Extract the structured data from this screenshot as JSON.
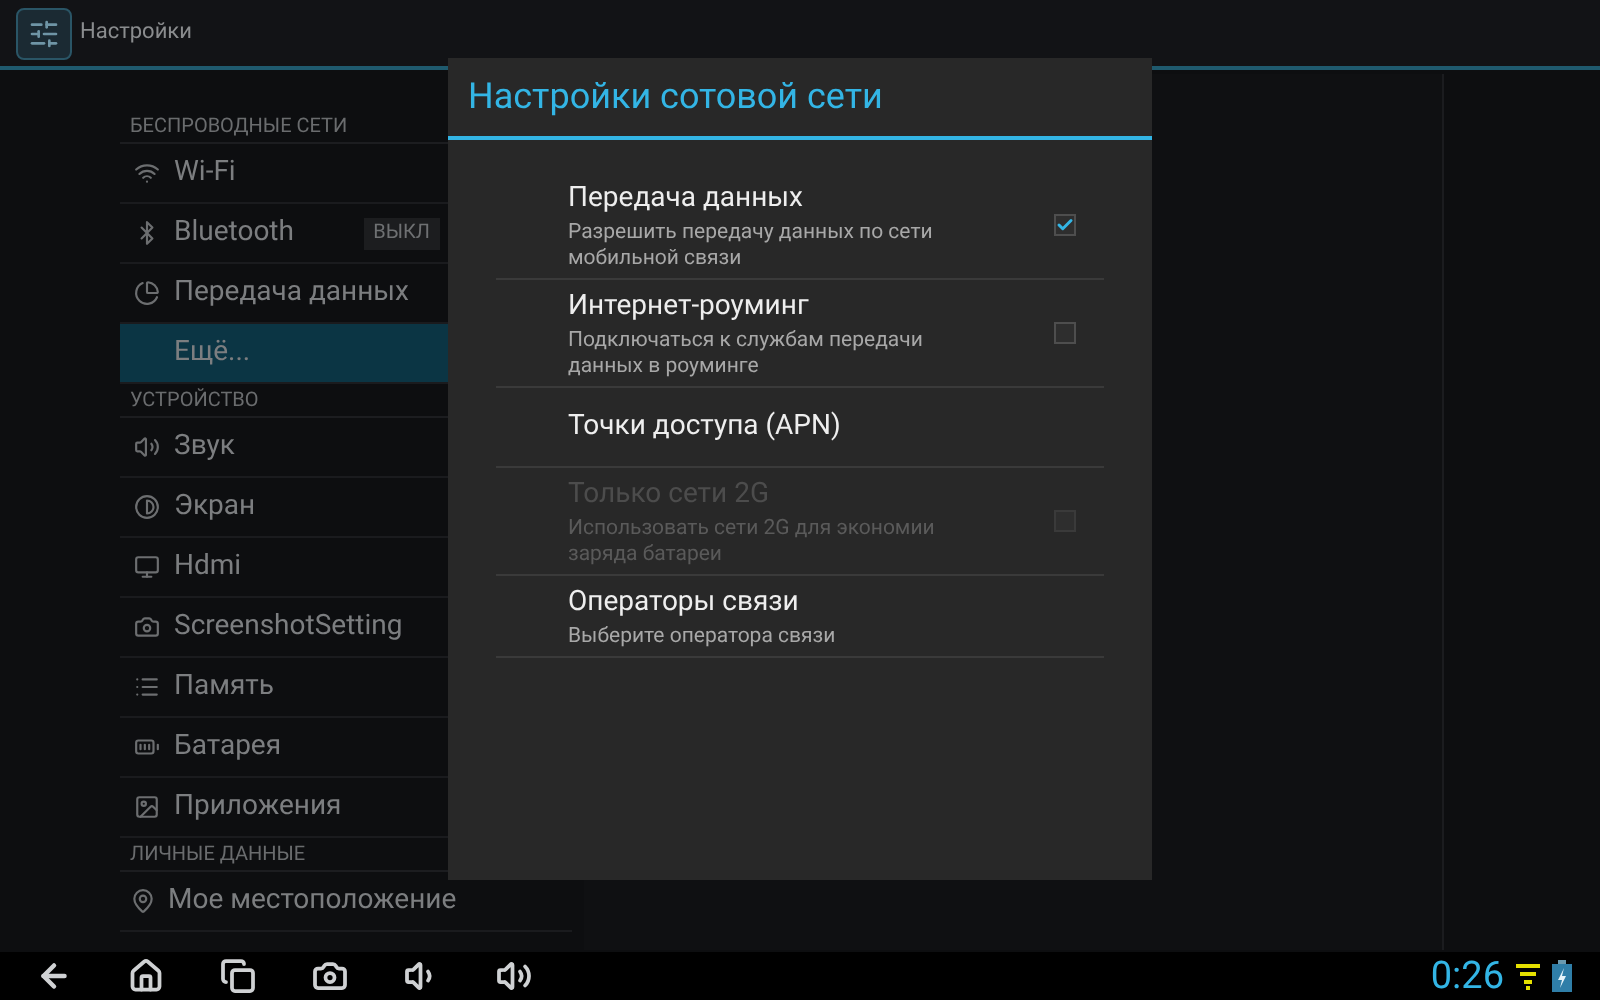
{
  "action_bar": {
    "title": "Настройки"
  },
  "sidebar": {
    "sections": [
      {
        "header": "БЕСПРОВОДНЫЕ СЕТИ",
        "items": [
          {
            "label": "Wi-Fi",
            "selected": false
          },
          {
            "label": "Bluetooth",
            "selected": false,
            "toggle": {
              "label": "ВЫКЛ"
            }
          },
          {
            "label": "Передача данных",
            "selected": false
          },
          {
            "label": "Ещё...",
            "selected": true
          }
        ]
      },
      {
        "header": "УСТРОЙСТВО",
        "items": [
          {
            "label": "Звук",
            "selected": false
          },
          {
            "label": "Экран",
            "selected": false
          },
          {
            "label": "Hdmi",
            "selected": false
          },
          {
            "label": "ScreenshotSetting",
            "selected": false
          },
          {
            "label": "Память",
            "selected": false
          },
          {
            "label": "Батарея",
            "selected": false
          },
          {
            "label": "Приложения",
            "selected": false
          }
        ]
      },
      {
        "header": "ЛИЧНЫЕ ДАННЫЕ",
        "items": [
          {
            "label": "Мое местоположение",
            "selected": false
          }
        ]
      }
    ]
  },
  "dialog": {
    "title": "Настройки сотовой сети",
    "items": [
      {
        "kind": "checkbox",
        "title": "Передача данных",
        "summary": "Разрешить передачу данных по сети мобильной связи",
        "checked": true,
        "disabled": false
      },
      {
        "kind": "checkbox",
        "title": "Интернет-роуминг",
        "summary": "Подключаться к службам передачи данных в роуминге",
        "checked": false,
        "disabled": false
      },
      {
        "kind": "plain",
        "title": "Точки доступа (APN)",
        "disabled": false
      },
      {
        "kind": "checkbox",
        "title": "Только сети 2G",
        "summary": "Использовать сети 2G для экономии заряда батареи",
        "checked": false,
        "disabled": true
      },
      {
        "kind": "plain",
        "title": "Операторы связи",
        "summary": "Выберите оператора связи",
        "disabled": false
      }
    ]
  },
  "status_bar": {
    "time": "0:26"
  }
}
